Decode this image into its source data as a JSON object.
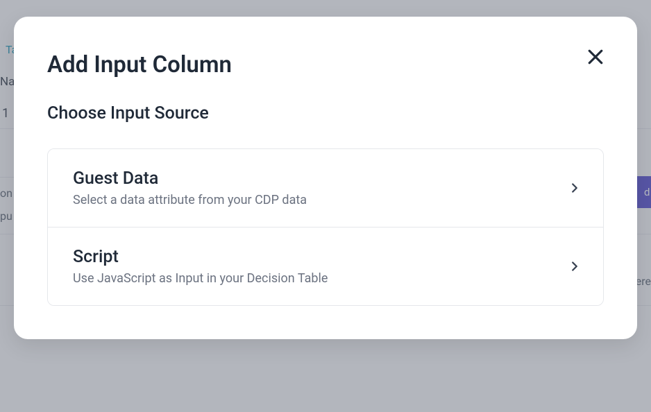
{
  "background": {
    "tab_label": "Ta",
    "text1": "Na",
    "text2": "1",
    "text3": "on",
    "text4": "pu",
    "button_label": "d",
    "text5": "ere"
  },
  "modal": {
    "title": "Add Input Column",
    "subtitle": "Choose Input Source",
    "options": [
      {
        "title": "Guest Data",
        "description": "Select a data attribute from your CDP data"
      },
      {
        "title": "Script",
        "description": "Use JavaScript as Input in your Decision Table"
      }
    ]
  }
}
